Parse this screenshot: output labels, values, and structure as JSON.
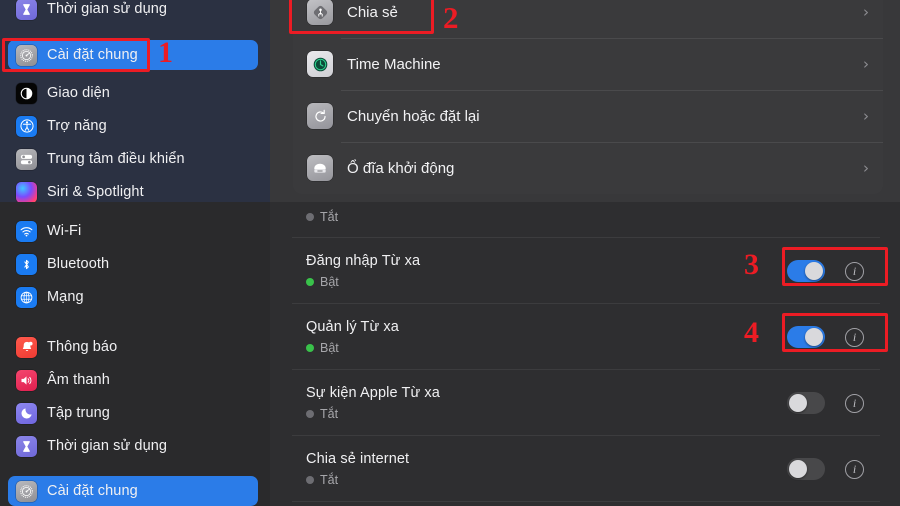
{
  "colors": {
    "accent_blue": "#2b7ce8",
    "annotation_red": "#ec1c24",
    "status_on_green": "#39c24a",
    "status_off_gray": "#6d6d72",
    "sidebar_top_bg": "#2b3142",
    "sidebar_bottom_bg": "#2a2a2c",
    "panel_top_bg": "#38383a",
    "panel_bottom_bg": "#2e2e30",
    "card_bg": "#3a3a3c"
  },
  "top_capture": {
    "sidebar": {
      "items": [
        {
          "label": "Thời gian sử dụng",
          "icon": "hourglass-icon",
          "selected": false
        },
        {
          "label": "Cài đặt chung",
          "icon": "gear-icon",
          "selected": true
        },
        {
          "label": "Giao diện",
          "icon": "appearance-icon",
          "selected": false
        },
        {
          "label": "Trợ năng",
          "icon": "accessibility-icon",
          "selected": false
        },
        {
          "label": "Trung tâm điều khiển",
          "icon": "control-center-icon",
          "selected": false
        },
        {
          "label": "Siri & Spotlight",
          "icon": "siri-icon",
          "selected": false
        }
      ]
    },
    "panel": {
      "rows": [
        {
          "label": "Chia sẻ",
          "icon": "sharing-icon",
          "chevron": "›"
        },
        {
          "label": "Time Machine",
          "icon": "time-machine-icon",
          "chevron": "›"
        },
        {
          "label": "Chuyển hoặc đặt lại",
          "icon": "transfer-reset-icon",
          "chevron": "›"
        },
        {
          "label": "Ổ đĩa khởi động",
          "icon": "startup-disk-icon",
          "chevron": "›"
        }
      ]
    }
  },
  "bottom_capture": {
    "sidebar": {
      "items": [
        {
          "label": "Wi-Fi",
          "icon": "wifi-icon",
          "selected": false
        },
        {
          "label": "Bluetooth",
          "icon": "bluetooth-icon",
          "selected": false
        },
        {
          "label": "Mạng",
          "icon": "network-icon",
          "selected": false
        },
        {
          "label": "Thông báo",
          "icon": "notifications-icon",
          "selected": false
        },
        {
          "label": "Âm thanh",
          "icon": "sound-icon",
          "selected": false
        },
        {
          "label": "Tập trung",
          "icon": "focus-icon",
          "selected": false
        },
        {
          "label": "Thời gian sử dụng",
          "icon": "hourglass-icon",
          "selected": false
        },
        {
          "label": "Cài đặt chung",
          "icon": "gear-icon",
          "selected": true
        }
      ]
    },
    "panel": {
      "clipped_top_row": {
        "status": "Tắt",
        "status_state": "off"
      },
      "rows": [
        {
          "title": "Đăng nhập Từ xa",
          "status": "Bật",
          "status_state": "on",
          "toggle": "on",
          "info": "i"
        },
        {
          "title": "Quản lý Từ xa",
          "status": "Bật",
          "status_state": "on",
          "toggle": "on",
          "info": "i"
        },
        {
          "title": "Sự kiện Apple Từ xa",
          "status": "Tắt",
          "status_state": "off",
          "toggle": "off",
          "info": "i"
        },
        {
          "title": "Chia sẻ internet",
          "status": "Tắt",
          "status_state": "off",
          "toggle": "off",
          "info": "i"
        }
      ]
    }
  },
  "annotations": {
    "numbers": [
      {
        "text": "1",
        "target": "sidebar-item-cai-dat-chung"
      },
      {
        "text": "2",
        "target": "panel-row-chia-se"
      },
      {
        "text": "3",
        "target": "toggle-dang-nhap-tu-xa"
      },
      {
        "text": "4",
        "target": "toggle-quan-ly-tu-xa"
      }
    ]
  }
}
